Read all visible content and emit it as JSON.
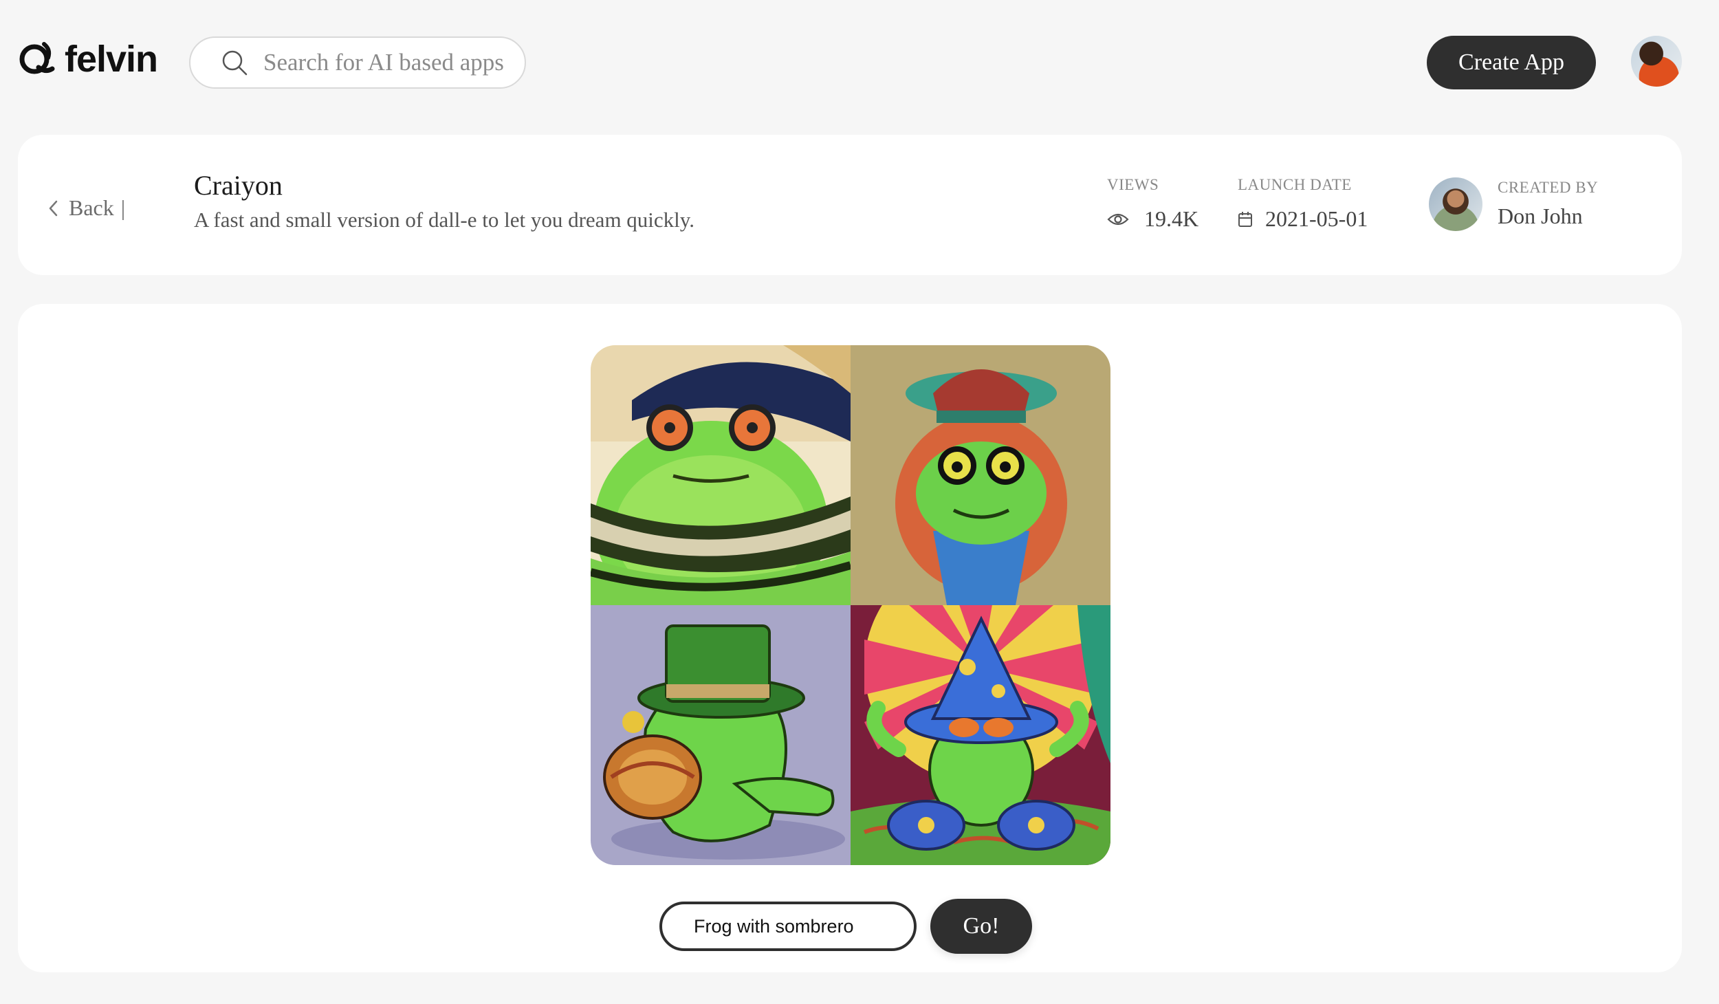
{
  "header": {
    "brand": "felvin",
    "search_placeholder": "Search for AI based apps",
    "create_label": "Create App"
  },
  "app": {
    "back_label": "Back",
    "back_separator": "|",
    "title": "Craiyon",
    "description": "A fast and small version of dall-e to let you dream quickly.",
    "views_label": "VIEWS",
    "views_value": "19.4K",
    "launch_label": "LAUNCH DATE",
    "launch_value": "2021-05-01",
    "creator_label": "CREATED BY",
    "creator_name": "Don John"
  },
  "generator": {
    "prompt_value": "Frog with sombrero",
    "go_label": "Go!"
  },
  "icons": {
    "search": "search-icon",
    "back": "chevron-left-icon",
    "views": "eye-icon",
    "launch": "calendar-icon"
  },
  "colors": {
    "background": "#f6f6f6",
    "card": "#ffffff",
    "button": "#2f2f2f"
  }
}
